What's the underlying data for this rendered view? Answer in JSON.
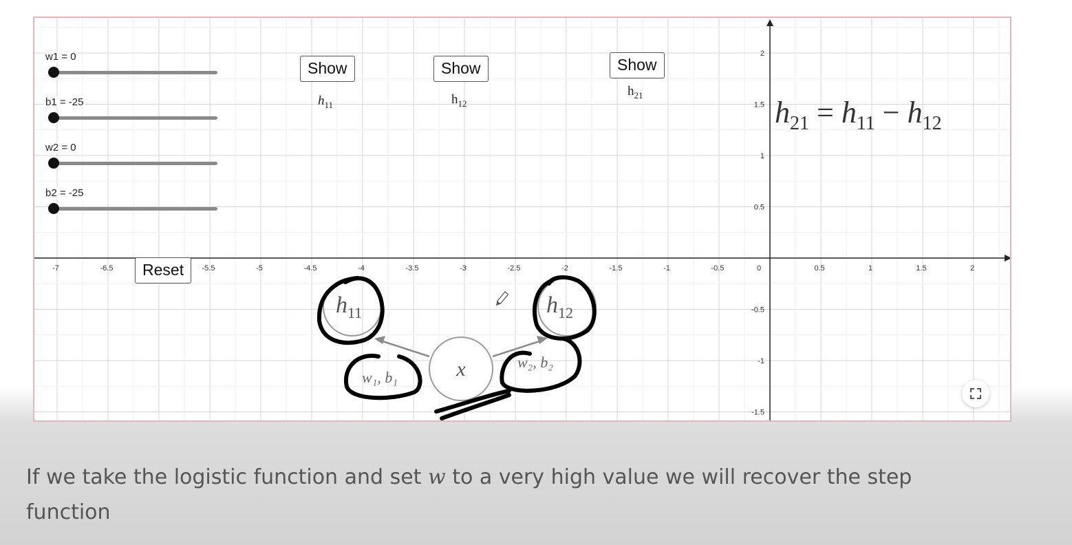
{
  "sliders": [
    {
      "label": "w1 = 0",
      "value": 0,
      "min": 0,
      "max": 100
    },
    {
      "label": "b1 = -25",
      "value": -25,
      "min": -25,
      "max": 25
    },
    {
      "label": "w2 = 0",
      "value": 0,
      "min": 0,
      "max": 100
    },
    {
      "label": "b2 = -25",
      "value": -25,
      "min": -25,
      "max": 25
    }
  ],
  "buttons": {
    "show1": "Show",
    "show2": "Show",
    "show3": "Show",
    "reset": "Reset"
  },
  "labels": {
    "h11_base": "h",
    "h11_sub": "11",
    "h12_base": "h",
    "h12_sub": "12",
    "h21_base": "h",
    "h21_sub": "21"
  },
  "equation": {
    "lhs": "h",
    "lhs_sub": "21",
    "eq": "=",
    "t1": "h",
    "t1_sub": "11",
    "minus": "−",
    "t2": "h",
    "t2_sub": "12"
  },
  "diagram": {
    "node_x": "x",
    "node_h11": "h",
    "node_h11_sub": "11",
    "node_h12": "h",
    "node_h12_sub": "12",
    "edge1": "w₁, b₁",
    "edge2": "w₂, b₂"
  },
  "axes": {
    "x_ticks": [
      "-7",
      "-6.5",
      "-6",
      "-5.5",
      "-5",
      "-4.5",
      "-4",
      "-3.5",
      "-3",
      "-2.5",
      "-2",
      "-1.5",
      "-1",
      "-0.5",
      "0",
      "0.5",
      "1",
      "1.5",
      "2"
    ],
    "y_ticks": [
      "2",
      "1.5",
      "1",
      "0.5",
      "-0.5",
      "-1",
      "-1.5"
    ]
  },
  "caption": {
    "part1": "If we take the logistic function and set ",
    "var": "w",
    "part2": " to a very high value we will recover the step function"
  },
  "colors": {
    "ink": "#000000",
    "grid": "#dcdcdc",
    "frame": "#e3b7b7"
  }
}
